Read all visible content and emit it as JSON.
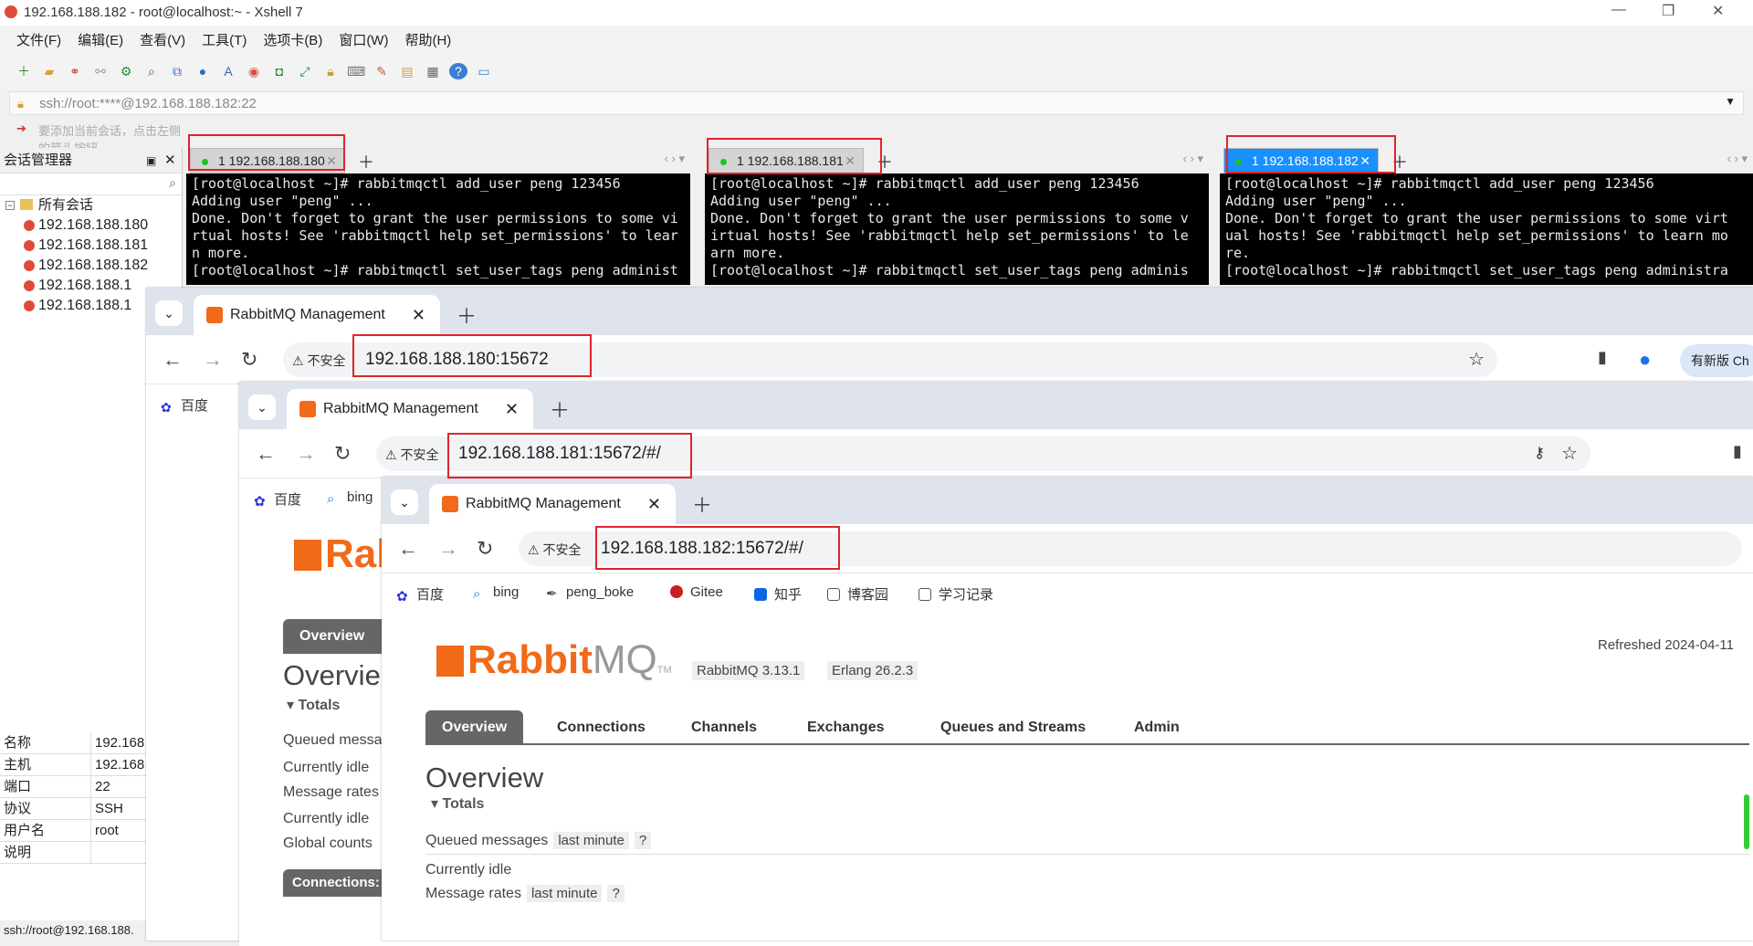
{
  "window": {
    "title": "192.168.188.182 - root@localhost:~ - Xshell 7",
    "menu": [
      "文件(F)",
      "编辑(E)",
      "查看(V)",
      "工具(T)",
      "选项卡(B)",
      "窗口(W)",
      "帮助(H)"
    ],
    "address": "ssh://root:****@192.168.188.182:22",
    "hint": "要添加当前会话，点击左侧的箭头按钮。"
  },
  "session_manager": {
    "title": "会话管理器",
    "root": "所有会话",
    "items": [
      "192.168.188.180",
      "192.168.188.181",
      "192.168.188.182",
      "192.168.188.1",
      "192.168.188.1"
    ],
    "props": [
      {
        "k": "名称",
        "v": "192.168"
      },
      {
        "k": "主机",
        "v": "192.168"
      },
      {
        "k": "端口",
        "v": "22"
      },
      {
        "k": "协议",
        "v": "SSH"
      },
      {
        "k": "用户名",
        "v": "root"
      },
      {
        "k": "说明",
        "v": ""
      }
    ],
    "status": "ssh://root@192.168.188."
  },
  "panes": [
    {
      "tab": "1 192.168.188.180",
      "text": "[root@localhost ~]# rabbitmqctl add_user peng 123456\nAdding user \"peng\" ...\nDone. Don't forget to grant the user permissions to some vi\nrtual hosts! See 'rabbitmqctl help set_permissions' to lear\nn more.\n[root@localhost ~]# rabbitmqctl set_user_tags peng administ"
    },
    {
      "tab": "1 192.168.188.181",
      "text": "[root@localhost ~]# rabbitmqctl add_user peng 123456\nAdding user \"peng\" ...\nDone. Don't forget to grant the user permissions to some v\nirtual hosts! See 'rabbitmqctl help set_permissions' to le\narn more.\n[root@localhost ~]# rabbitmqctl set_user_tags peng adminis"
    },
    {
      "tab": "1 192.168.188.182",
      "text": "[root@localhost ~]# rabbitmqctl add_user peng 123456\nAdding user \"peng\" ...\nDone. Don't forget to grant the user permissions to some virt\nual hosts! See 'rabbitmqctl help set_permissions' to learn mo\nre.\n[root@localhost ~]# rabbitmqctl set_user_tags peng administra"
    }
  ],
  "browsers": [
    {
      "tab_title": "RabbitMQ Management",
      "insecure": "不安全",
      "url": "192.168.188.180:15672",
      "update_label": "有新版 Ch",
      "bookmarks": [
        "百度"
      ]
    },
    {
      "tab_title": "RabbitMQ Management",
      "insecure": "不安全",
      "url": "192.168.188.181:15672/#/",
      "bookmarks": [
        "百度",
        "bing"
      ]
    },
    {
      "tab_title": "RabbitMQ Management",
      "insecure": "不安全",
      "url": "192.168.188.182:15672/#/",
      "bookmarks": [
        "百度",
        "bing",
        "peng_boke",
        "Gitee",
        "知乎",
        "博客园",
        "学习记录"
      ]
    }
  ],
  "rabbitmq": {
    "logo": "Rabbit",
    "logo_mq": "MQ",
    "tm": "TM",
    "version": "RabbitMQ 3.13.1",
    "erlang": "Erlang 26.2.3",
    "refreshed": "Refreshed 2024-04-11",
    "nav": [
      "Overview",
      "Connections",
      "Channels",
      "Exchanges",
      "Queues and Streams",
      "Admin"
    ],
    "heading": "Overview",
    "totals": "Totals",
    "queued": "Queued messages",
    "last_minute": "last minute",
    "help": "?",
    "idle": "Currently idle",
    "rates": "Message rates",
    "global": "Global counts",
    "connections": "Connections:",
    "b2_lines": [
      "Queued messa",
      "Currently idle",
      "Message rates",
      "Currently idle",
      "Global counts"
    ],
    "b2_heading": "Overvie",
    "b2_logo": "Rab"
  }
}
